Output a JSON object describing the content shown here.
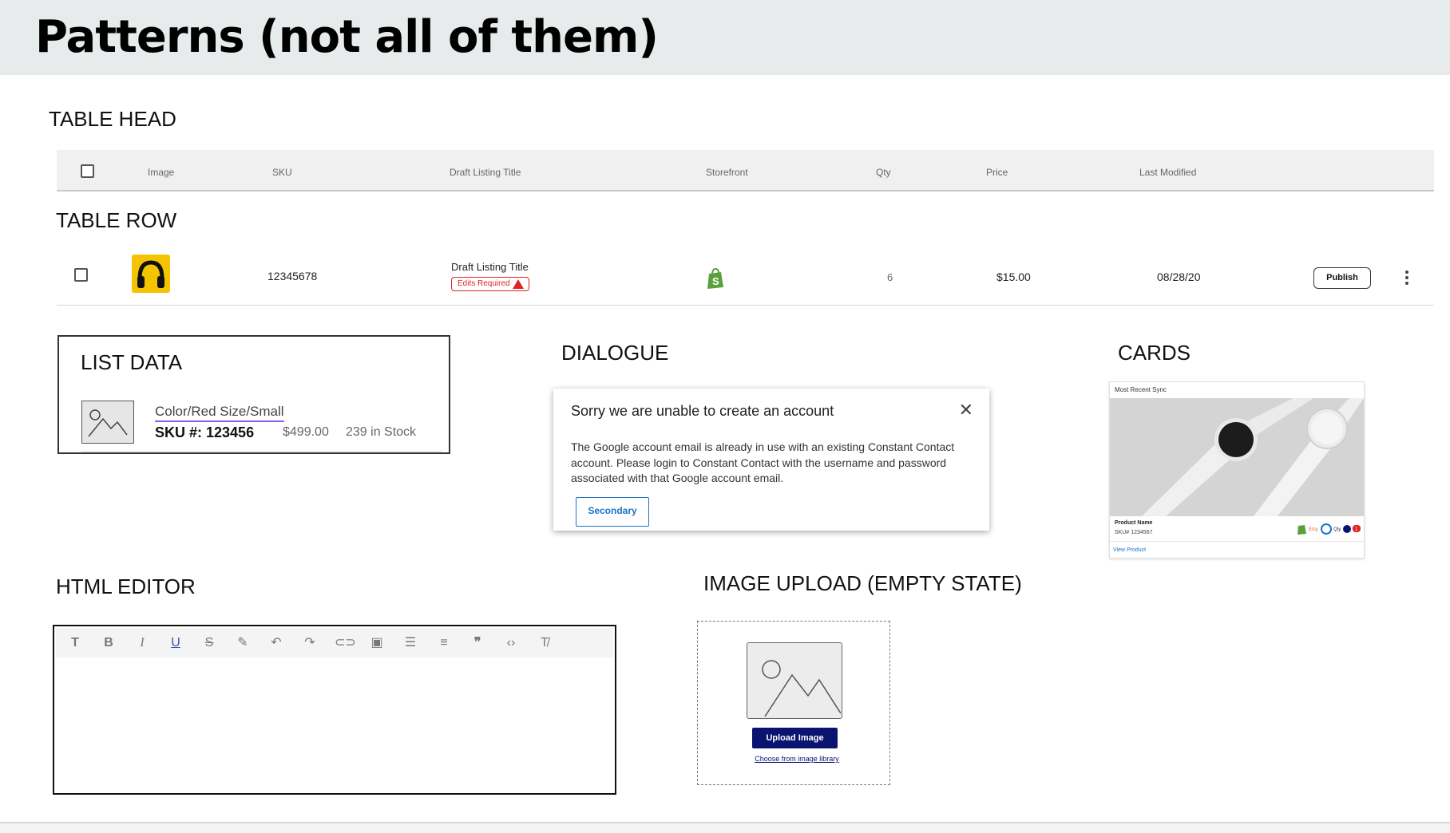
{
  "header": {
    "title": "Patterns (not all of them)"
  },
  "sections": {
    "table_head": "TABLE HEAD",
    "table_row": "TABLE ROW",
    "list_data": "LIST DATA",
    "dialogue": "DIALOGUE",
    "cards": "CARDS",
    "html_editor": "HTML EDITOR",
    "image_upload": "IMAGE UPLOAD (EMPTY STATE)"
  },
  "table": {
    "columns": [
      "Image",
      "SKU",
      "Draft Listing Title",
      "Storefront",
      "Qty",
      "Price",
      "Last Modified"
    ],
    "row": {
      "sku": "12345678",
      "title": "Draft Listing Title",
      "badge": "Edits Required",
      "storefront_icon": "shopify-icon",
      "qty": "6",
      "price": "$15.00",
      "last_modified": "08/28/20",
      "action": "Publish"
    }
  },
  "list_data": {
    "attributes": "Color/Red   Size/Small",
    "sku": "SKU #: 123456",
    "price": "$499.00",
    "stock": "239 in Stock"
  },
  "dialog": {
    "title": "Sorry we are unable to create an account",
    "body": "The Google account email is already in use with an existing Constant Contact account.  Please login to Constant Contact with the username and password associated with that Google account email.",
    "button": "Secondary",
    "close_icon": "close-icon"
  },
  "card": {
    "header": "Most Recent Sync",
    "product_name": "Product Name",
    "sku": "SKU# 1234567",
    "link": "View Product",
    "etsy_label": "Etsy",
    "qty_label": "Qty",
    "badge_count": "1"
  },
  "editor": {
    "tools": [
      "text-style-icon",
      "bold-icon",
      "italic-icon",
      "underline-icon",
      "strikethrough-icon",
      "highlight-icon",
      "undo-icon",
      "redo-icon",
      "link-icon",
      "image-icon",
      "bullet-list-icon",
      "numbered-list-icon",
      "quote-icon",
      "code-icon",
      "clear-format-icon"
    ],
    "active_tool": "underline-icon"
  },
  "upload": {
    "button": "Upload Image",
    "link": "Choose from image library"
  },
  "colors": {
    "header_bg": "#e8ebec",
    "error_red": "#e02424",
    "link_blue": "#1a73c9",
    "upload_navy": "#0a1470",
    "shopify_green": "#5aa03c",
    "list_underline": "#8a5cf0"
  }
}
